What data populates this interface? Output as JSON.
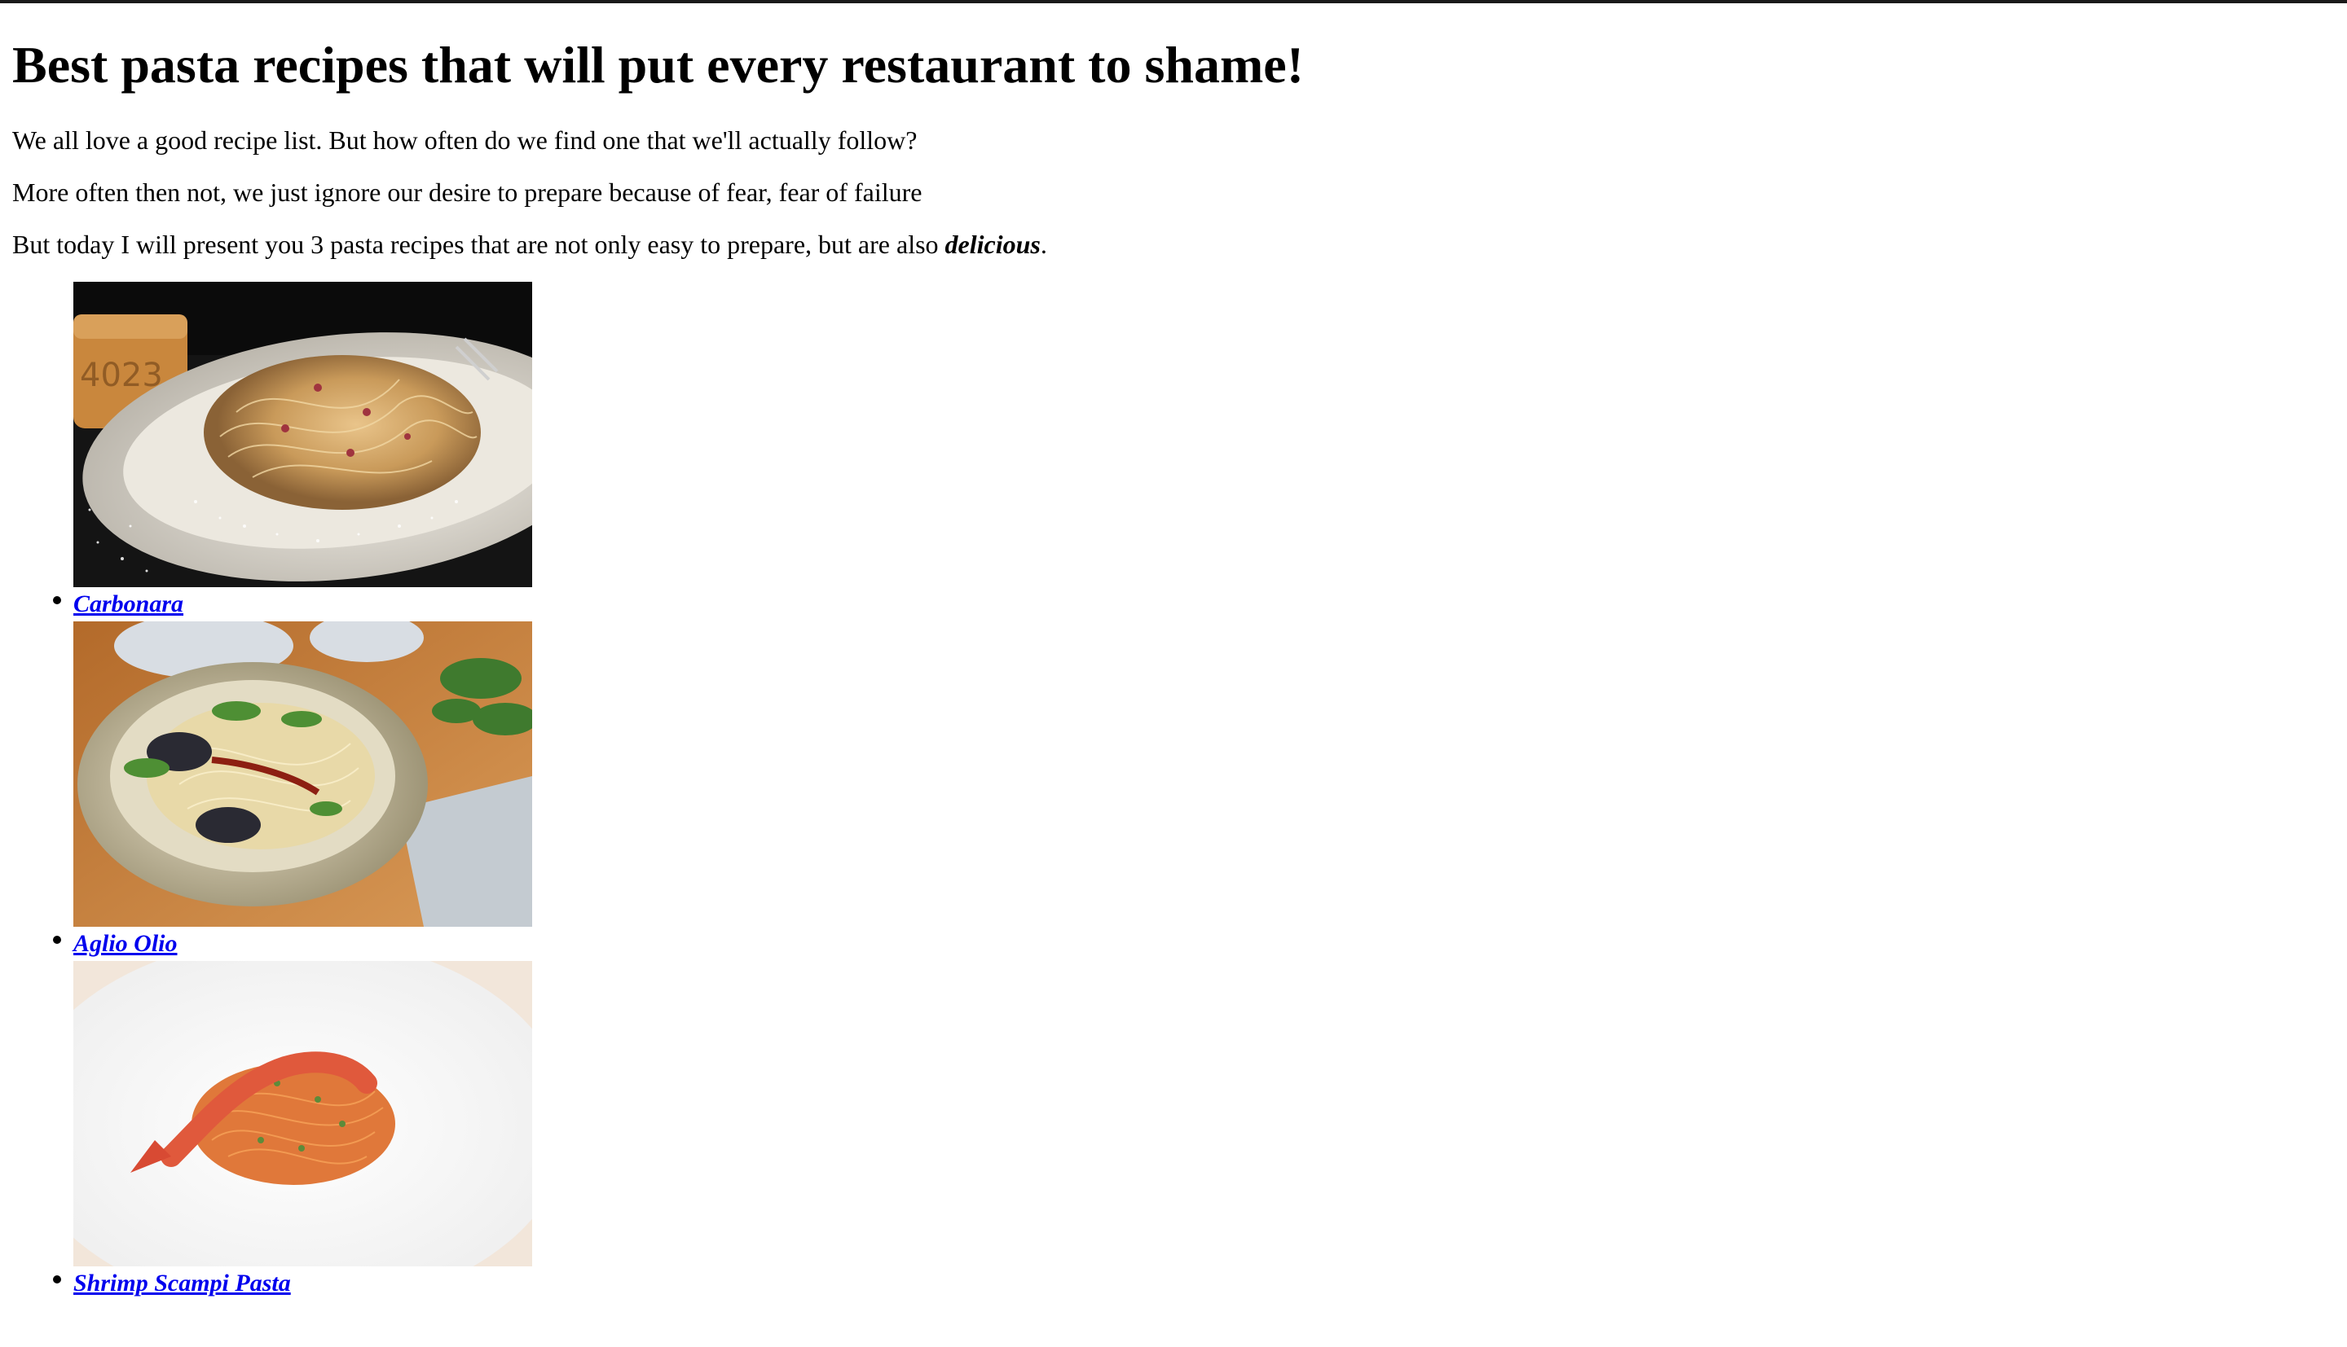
{
  "heading": "Best pasta recipes that will put every restaurant to shame!",
  "paragraphs": {
    "p1": "We all love a good recipe list. But how often do we find one that we'll actually follow?",
    "p2": "More often then not, we just ignore our desire to prepare because of fear, fear of failure",
    "p3_before": "But today I will present you 3 pasta recipes that are not only easy to prepare, but are also ",
    "p3_emphasis": "delicious",
    "p3_after": "."
  },
  "recipes": [
    {
      "name": "Carbonara",
      "image_desc": "carbonara-photo"
    },
    {
      "name": "Aglio Olio",
      "image_desc": "aglio-olio-photo"
    },
    {
      "name": "Shrimp Scampi Pasta",
      "image_desc": "shrimp-scampi-photo"
    }
  ],
  "colors": {
    "link": "#0000ee",
    "text": "#000000",
    "top_border": "#1a1a1a"
  }
}
